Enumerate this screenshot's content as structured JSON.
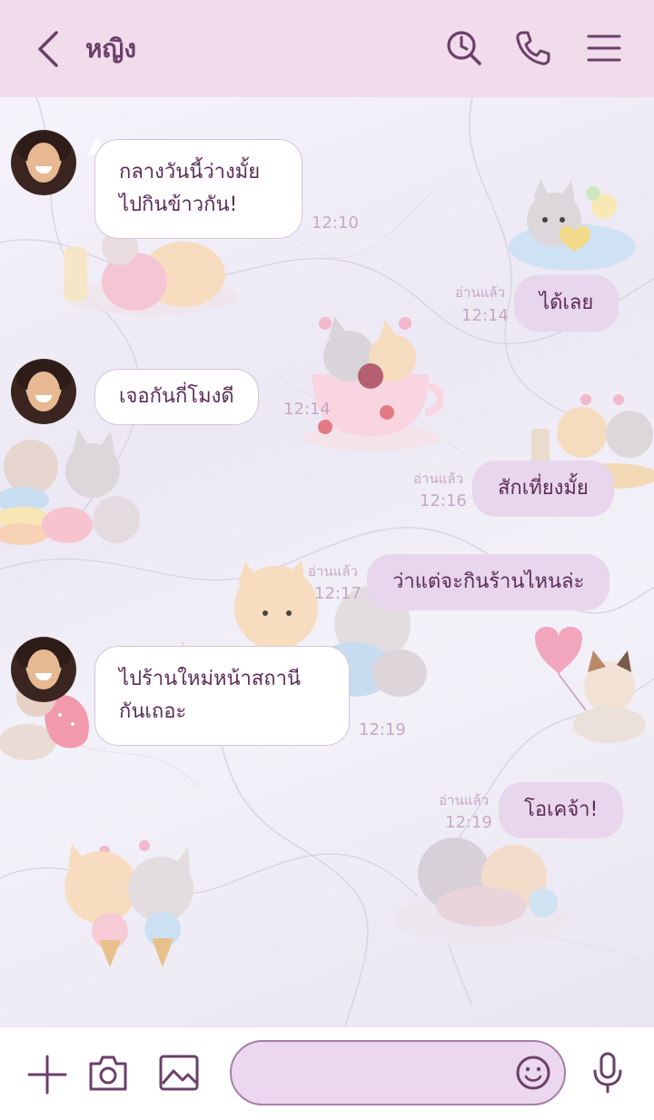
{
  "header": {
    "title": "หญิง",
    "icons": [
      "back-chevron-icon",
      "history-clock-search-icon",
      "phone-icon",
      "menu-icon"
    ]
  },
  "colors": {
    "header_bg": "#f0dcea",
    "accent": "#6b3f6a",
    "outgoing_bubble": "#e8d6ec",
    "incoming_bubble": "#ffffff",
    "timestamp": "#c7a8c5"
  },
  "messages": [
    {
      "side": "in",
      "text_lines": [
        "กลางวันนี้ว่างมั้ย",
        "ไปกินข้าวกัน!"
      ],
      "time": "12:10"
    },
    {
      "side": "out",
      "text": "ได้เลย",
      "read": "อ่านแล้ว",
      "time": "12:14"
    },
    {
      "side": "in",
      "text": "เจอกันกี่โมงดี",
      "time": "12:14"
    },
    {
      "side": "out",
      "text": "สักเที่ยงมั้ย",
      "read": "อ่านแล้ว",
      "time": "12:16"
    },
    {
      "side": "out",
      "text": "ว่าแต่จะกินร้านไหนล่ะ",
      "read": "อ่านแล้ว",
      "time": "12:17"
    },
    {
      "side": "in",
      "text_lines": [
        "ไปร้านใหม่หน้าสถานี",
        "กันเถอะ"
      ],
      "time": "12:19"
    },
    {
      "side": "out",
      "text": "โอเคจ้า!",
      "read": "อ่านแล้ว",
      "time": "12:19"
    }
  ],
  "footer": {
    "icons": [
      "plus-icon",
      "camera-icon",
      "image-icon",
      "emoji-icon",
      "microphone-icon"
    ],
    "input_placeholder": ""
  }
}
